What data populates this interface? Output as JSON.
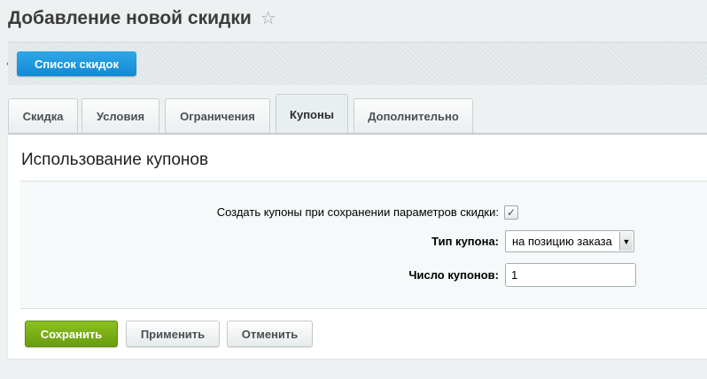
{
  "page": {
    "title": "Добавление новой скидки",
    "star_icon": "☆"
  },
  "toolbar": {
    "back_label": "Список скидок"
  },
  "tabs": [
    {
      "label": "Скидка",
      "active": false
    },
    {
      "label": "Условия",
      "active": false
    },
    {
      "label": "Ограничения",
      "active": false
    },
    {
      "label": "Купоны",
      "active": true
    },
    {
      "label": "Дополнительно",
      "active": false
    }
  ],
  "section": {
    "title": "Использование купонов"
  },
  "form": {
    "create_coupons_label": "Создать купоны при сохранении параметров скидки:",
    "create_coupons_checked": true,
    "coupon_type_label": "Тип купона:",
    "coupon_type_value": "на позицию заказа",
    "coupon_count_label": "Число купонов:",
    "coupon_count_value": "1"
  },
  "buttons": {
    "save": "Сохранить",
    "apply": "Применить",
    "cancel": "Отменить"
  },
  "colors": {
    "accent_blue": "#1a91dd",
    "save_green": "#7aad18"
  }
}
